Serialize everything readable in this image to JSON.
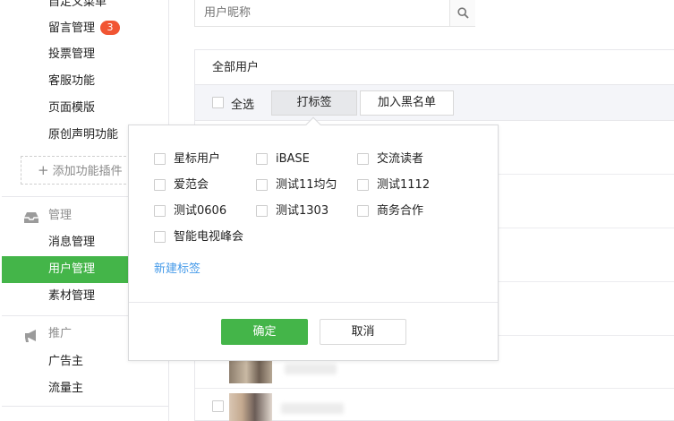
{
  "sidebar": {
    "items_top": [
      {
        "label": "自定义菜单"
      },
      {
        "label": "留言管理",
        "badge": "3"
      },
      {
        "label": "投票管理"
      },
      {
        "label": "客服功能"
      },
      {
        "label": "页面模版"
      },
      {
        "label": "原创声明功能"
      }
    ],
    "add_plugin_label": "添加功能插件",
    "manage_group": {
      "title": "管理",
      "icon": "inbox-icon",
      "items": [
        {
          "label": "消息管理"
        },
        {
          "label": "用户管理",
          "active": true
        },
        {
          "label": "素材管理"
        }
      ]
    },
    "promo_group": {
      "title": "推广",
      "icon": "megaphone-icon",
      "items": [
        {
          "label": "广告主"
        },
        {
          "label": "流量主"
        }
      ]
    }
  },
  "search": {
    "placeholder": "用户昵称",
    "icon": "search-icon"
  },
  "panel": {
    "title": "全部用户",
    "select_all_label": "全选",
    "tag_button_label": "打标签",
    "blacklist_button_label": "加入黑名单"
  },
  "tag_popover": {
    "tags": [
      {
        "label": "星标用户",
        "checked": false
      },
      {
        "label": "iBASE",
        "checked": false
      },
      {
        "label": "交流读者",
        "checked": false
      },
      {
        "label": "爱范会",
        "checked": false
      },
      {
        "label": "测试11均匀",
        "checked": false
      },
      {
        "label": "测试1112",
        "checked": false
      },
      {
        "label": "测试0606",
        "checked": false
      },
      {
        "label": "测试1303",
        "checked": false
      },
      {
        "label": "商务合作",
        "checked": false
      },
      {
        "label": "智能电视峰会",
        "checked": false
      }
    ],
    "new_tag_label": "新建标签",
    "confirm_label": "确定",
    "cancel_label": "取消"
  },
  "colors": {
    "accent_green": "#44b549",
    "badge_red": "#f15533",
    "link_blue": "#459ae9"
  }
}
